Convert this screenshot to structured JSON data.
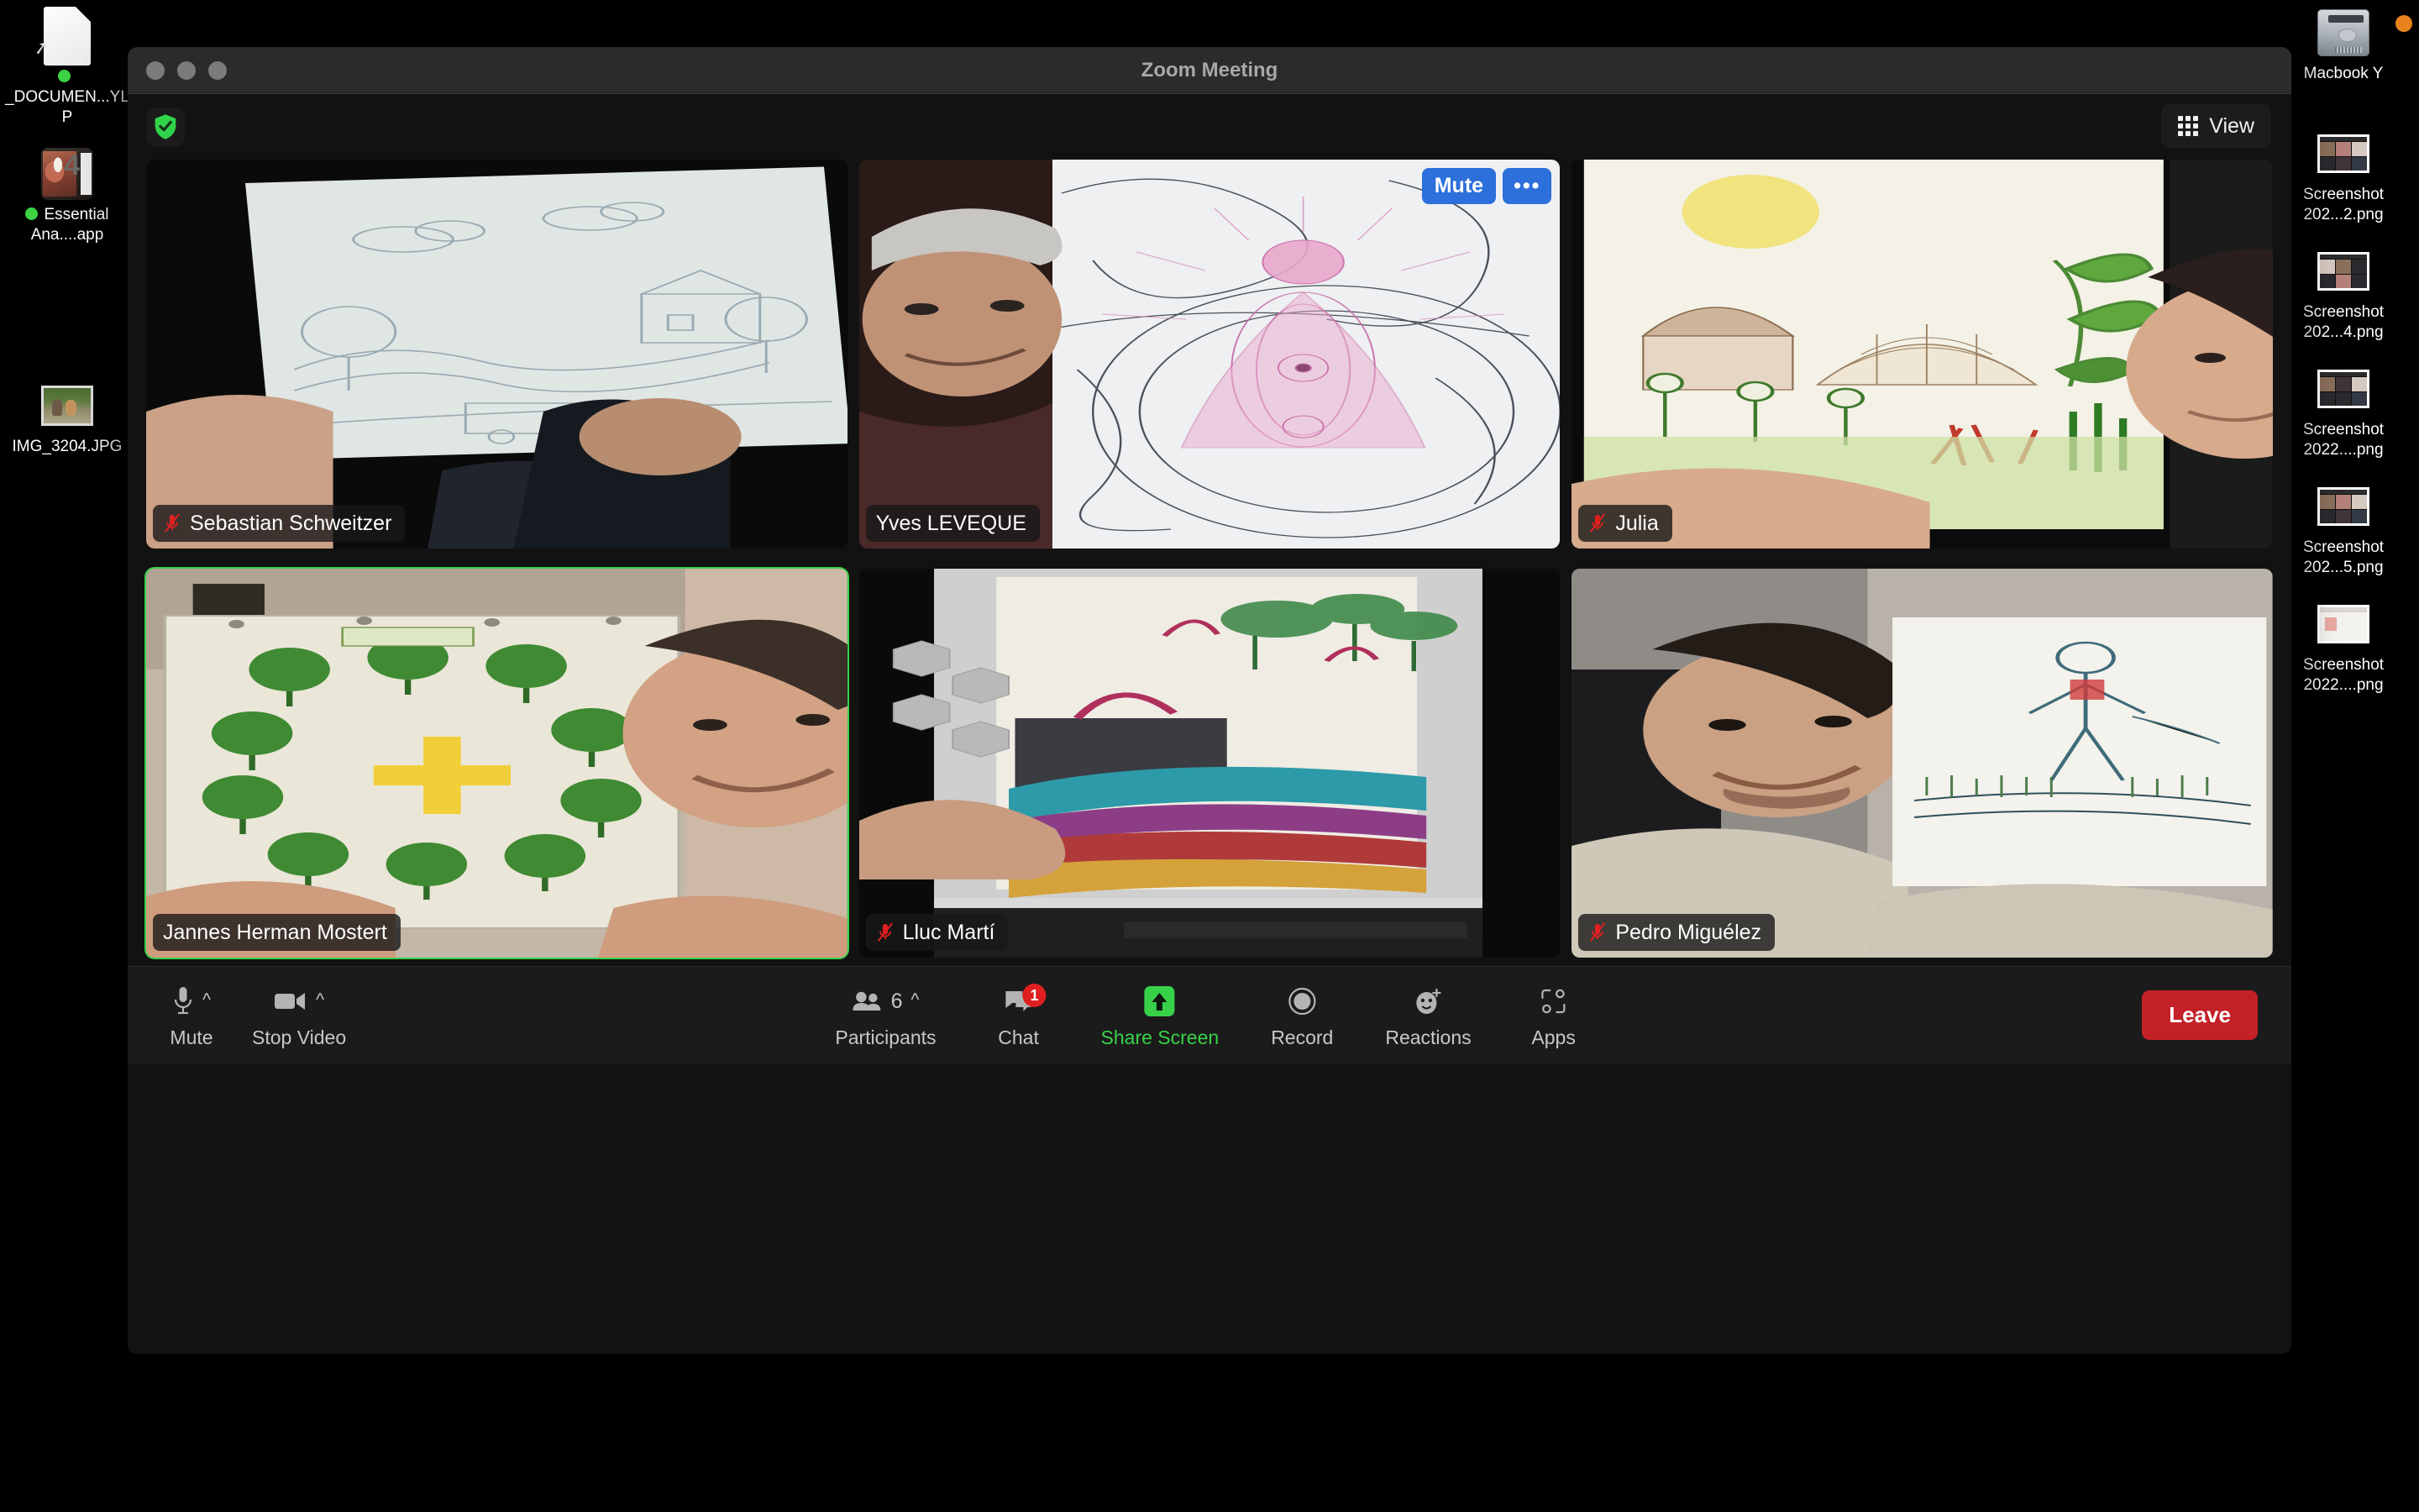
{
  "desktop": {
    "left_icons": [
      {
        "label": "_DOCUMEN...YLP",
        "icon": "document-icon",
        "has_badge": true
      },
      {
        "label": "Essential Ana....app",
        "icon": "anatomy-app-icon",
        "has_badge": true
      },
      {
        "label": "IMG_3204.JPG",
        "icon": "photo-icon",
        "has_badge": false
      }
    ],
    "right_icons": [
      {
        "label": "Macbook Y",
        "icon": "hard-drive-icon"
      },
      {
        "label": "Screenshot 202...2.png",
        "icon": "screenshot-icon"
      },
      {
        "label": "Screenshot 202...4.png",
        "icon": "screenshot-icon"
      },
      {
        "label": "Screenshot 2022....png",
        "icon": "screenshot-icon"
      },
      {
        "label": "Screenshot 202...5.png",
        "icon": "screenshot-icon"
      },
      {
        "label": "Screenshot 2022....png",
        "icon": "screenshot-doc-icon"
      }
    ]
  },
  "window": {
    "title": "Zoom Meeting"
  },
  "topbar": {
    "encryption_icon": "shield-check-icon",
    "view_label": "View",
    "view_icon": "grid-icon"
  },
  "participants": [
    {
      "name": "Sebastian Schweitzer",
      "muted": true,
      "active_speaker": false,
      "hover_controls": false,
      "drawing": "pencil-sketch-landscape-house-clouds"
    },
    {
      "name": "Yves LEVEQUE",
      "muted": false,
      "active_speaker": false,
      "hover_controls": true,
      "mute_label": "Mute",
      "more_label": "•••",
      "drawing": "pink-meditating-figure-radiating-lines"
    },
    {
      "name": "Julia",
      "muted": true,
      "active_speaker": false,
      "hover_controls": false,
      "drawing": "colored-pencil-garden-dome-hut-plants"
    },
    {
      "name": "Jannes Herman Mostert",
      "muted": false,
      "active_speaker": true,
      "hover_controls": false,
      "drawing": "green-trees-circle-with-yellow-cross"
    },
    {
      "name": "Lluc Martí",
      "muted": true,
      "active_speaker": false,
      "hover_controls": false,
      "drawing": "pastel-landscape-teal-river-red-figures"
    },
    {
      "name": "Pedro Miguélez",
      "muted": true,
      "active_speaker": false,
      "hover_controls": false,
      "drawing": "stick-person-on-grass-lines"
    }
  ],
  "toolbar": {
    "left": [
      {
        "label": "Mute",
        "icon": "microphone-icon",
        "has_caret": true
      },
      {
        "label": "Stop Video",
        "icon": "video-camera-icon",
        "has_caret": true
      }
    ],
    "center": [
      {
        "label": "Participants",
        "icon": "people-icon",
        "count": "6",
        "has_caret": true
      },
      {
        "label": "Chat",
        "icon": "chat-bubble-icon",
        "badge": "1"
      },
      {
        "label": "Share Screen",
        "icon": "share-screen-arrow-icon",
        "highlight": true
      },
      {
        "label": "Record",
        "icon": "record-circle-icon"
      },
      {
        "label": "Reactions",
        "icon": "smiley-plus-icon"
      },
      {
        "label": "Apps",
        "icon": "apps-bracket-icon"
      }
    ],
    "leave_label": "Leave"
  },
  "colors": {
    "accent_green": "#38d249",
    "leave_red": "#c42027",
    "mute_blue": "#2d6fdb",
    "badge_red": "#e02020",
    "window_bg": "#1f1f1f",
    "meeting_bg": "#121212"
  }
}
